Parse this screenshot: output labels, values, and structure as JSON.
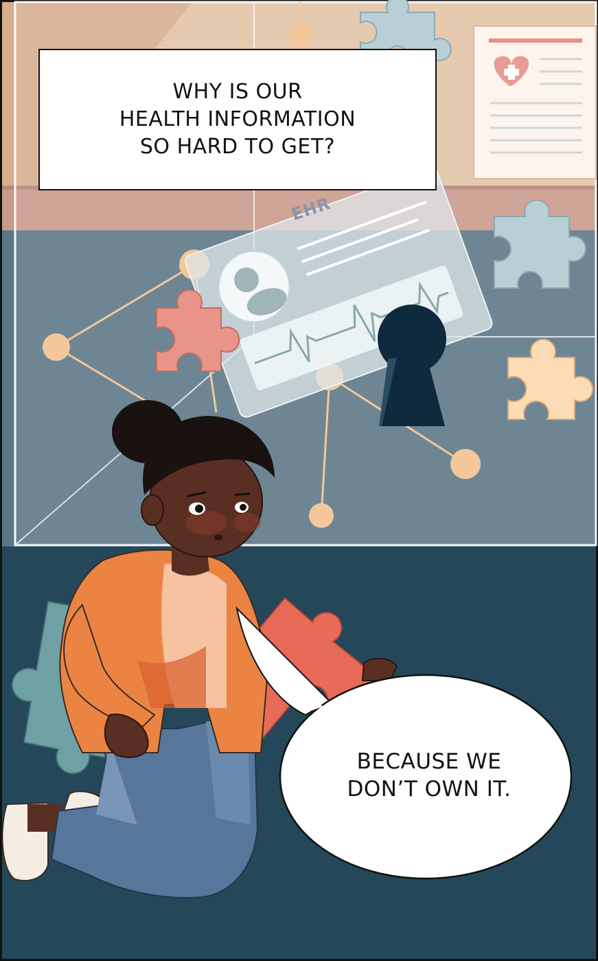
{
  "caption": {
    "lines": [
      "WHY IS OUR",
      "HEALTH INFORMATION",
      "SO HARD TO GET?"
    ]
  },
  "speech_bubble": {
    "lines": [
      "BECAUSE WE",
      "DON’T OWN IT."
    ]
  },
  "ehr_card": {
    "label": "EHR"
  },
  "colors": {
    "wall": "#e2c3a6",
    "floor_dark": "#244759",
    "glass_panel": "#6f8797",
    "network_node": "#f3c79a",
    "puzzle_red": "#e76b56",
    "puzzle_teal": "#6fa1a4",
    "puzzle_blue": "#b8cfd6",
    "puzzle_pink": "#e99488",
    "puzzle_yellow": "#fbdcb4",
    "jacket": "#eb8443",
    "jeans": "#56769c",
    "skin": "#5a2f23",
    "keyhole": "#0f2a3d"
  }
}
